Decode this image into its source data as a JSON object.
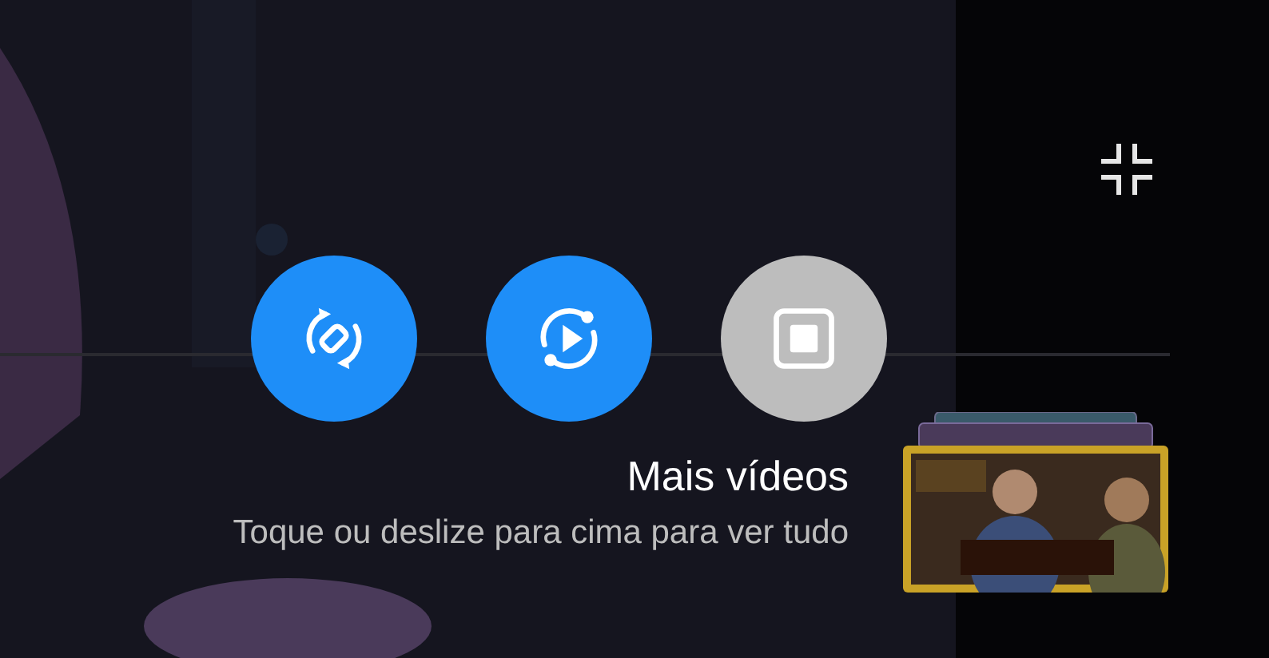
{
  "buttons": [
    {
      "kind": "rotate",
      "on": true
    },
    {
      "kind": "autoplay",
      "on": true
    },
    {
      "kind": "pip",
      "on": false
    }
  ],
  "more_videos": {
    "title": "Mais vídeos",
    "hint": "Toque ou deslize para cima para ver tudo"
  }
}
